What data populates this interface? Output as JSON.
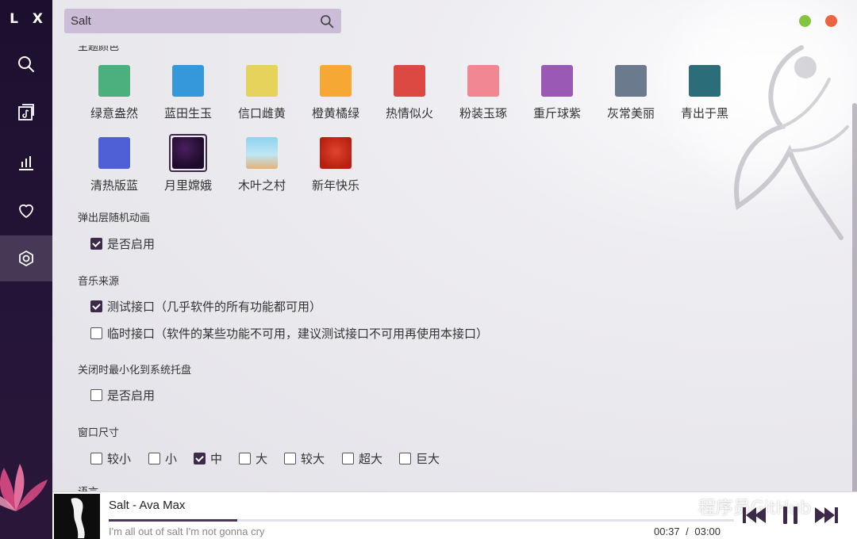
{
  "app": {
    "logo": "L X"
  },
  "sidebar": {
    "items": [
      {
        "icon": "search-icon"
      },
      {
        "icon": "music-list-icon"
      },
      {
        "icon": "chart-icon"
      },
      {
        "icon": "heart-icon"
      },
      {
        "icon": "settings-icon",
        "active": true
      }
    ]
  },
  "search": {
    "value": "Salt",
    "placeholder": ""
  },
  "settings": {
    "theme_title": "主题颜色",
    "themes": [
      {
        "label": "绿意盎然",
        "color": "#4caf7e"
      },
      {
        "label": "蓝田生玉",
        "color": "#3498db"
      },
      {
        "label": "信口雌黄",
        "color": "#e6d35c"
      },
      {
        "label": "橙黄橘绿",
        "color": "#f5a833"
      },
      {
        "label": "热情似火",
        "color": "#dc4842"
      },
      {
        "label": "粉装玉琢",
        "color": "#f08792"
      },
      {
        "label": "重斤球紫",
        "color": "#9b59b6"
      },
      {
        "label": "灰常美丽",
        "color": "#6b7a8d"
      },
      {
        "label": "青出于黑",
        "color": "#2b6d78"
      },
      {
        "label": "清热版蓝",
        "color": "#4f5fd6"
      },
      {
        "label": "月里嫦娥",
        "color": "#2b1236",
        "selected": true
      },
      {
        "label": "木叶之村",
        "color": "#8fcbe5"
      },
      {
        "label": "新年快乐",
        "color": "#c0291d"
      }
    ],
    "popup_anim_title": "弹出层随机动画",
    "popup_anim_option": "是否启用",
    "source_title": "音乐来源",
    "source_options": [
      {
        "label": "测试接口（几乎软件的所有功能都可用）",
        "checked": true
      },
      {
        "label": "临时接口（软件的某些功能不可用，建议测试接口不可用再使用本接口）",
        "checked": false
      }
    ],
    "tray_title": "关闭时最小化到系统托盘",
    "tray_option": "是否启用",
    "window_title": "窗口尺寸",
    "window_sizes": [
      {
        "label": "较小",
        "checked": false
      },
      {
        "label": "小",
        "checked": false
      },
      {
        "label": "中",
        "checked": true
      },
      {
        "label": "大",
        "checked": false
      },
      {
        "label": "较大",
        "checked": false
      },
      {
        "label": "超大",
        "checked": false
      },
      {
        "label": "巨大",
        "checked": false
      }
    ],
    "language_title": "语言"
  },
  "player": {
    "title": "Salt - Ava Max",
    "lyric": "I'm all out of salt I'm not gonna cry",
    "current_time": "00:37",
    "separator": "/",
    "total_time": "03:00",
    "progress": 0.205
  },
  "watermark": "程序员GitHub",
  "colors": {
    "accent": "#3c2a48",
    "sidebar": "#1c0f2e",
    "search_bg": "#cbbdd7",
    "min_btn": "#85c43f",
    "close_btn": "#e9643f"
  }
}
